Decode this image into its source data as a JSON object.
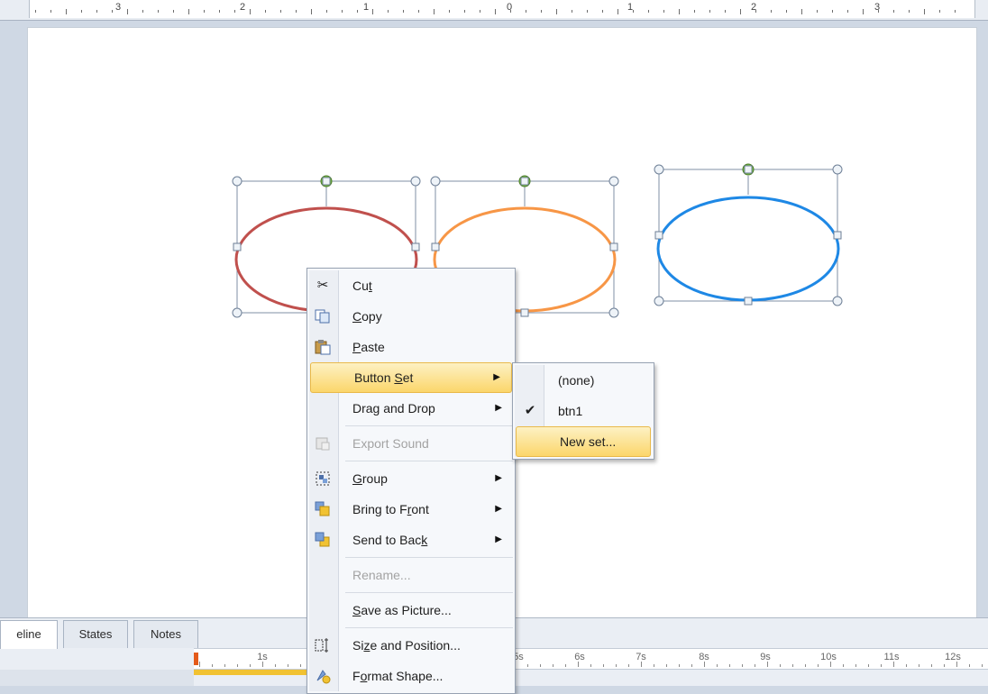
{
  "ruler": {
    "numbers": [
      "3",
      "2",
      "1",
      "0",
      "1",
      "2",
      "3"
    ]
  },
  "shapes": [
    {
      "name": "red-ellipse",
      "color": "#c0504d"
    },
    {
      "name": "orange-ellipse",
      "color": "#f79646"
    },
    {
      "name": "blue-ellipse",
      "color": "#1e88e5"
    }
  ],
  "context_menu": {
    "cut": {
      "pre": "Cu",
      "key": "t",
      "post": ""
    },
    "copy": {
      "pre": "",
      "key": "C",
      "post": "opy"
    },
    "paste": {
      "pre": "",
      "key": "P",
      "post": "aste"
    },
    "button_set": {
      "pre": "Button ",
      "key": "S",
      "post": "et"
    },
    "drag_drop": "Drag and Drop",
    "export_sound": "Export Sound",
    "group": {
      "pre": "",
      "key": "G",
      "post": "roup"
    },
    "bring_front": {
      "pre": "Bring to F",
      "key": "r",
      "post": "ont"
    },
    "send_back": {
      "pre": "Send to Bac",
      "key": "k",
      "post": ""
    },
    "rename": "Rename...",
    "save_picture": {
      "pre": "",
      "key": "S",
      "post": "ave as Picture..."
    },
    "size_position": {
      "pre": "Si",
      "key": "z",
      "post": "e and Position..."
    },
    "format_shape": {
      "pre": "F",
      "key": "o",
      "post": "rmat Shape..."
    }
  },
  "submenu": {
    "none": "(none)",
    "btn1": "btn1",
    "new_set": "New set..."
  },
  "timeline": {
    "tabs": [
      "eline",
      "States",
      "Notes"
    ],
    "labels": [
      "1s",
      "5s",
      "6s",
      "7s",
      "8s",
      "9s",
      "10s",
      "11s",
      "12s"
    ]
  },
  "colors": {
    "highlight": "#fbd66b",
    "handle_green": "#7ac143"
  }
}
